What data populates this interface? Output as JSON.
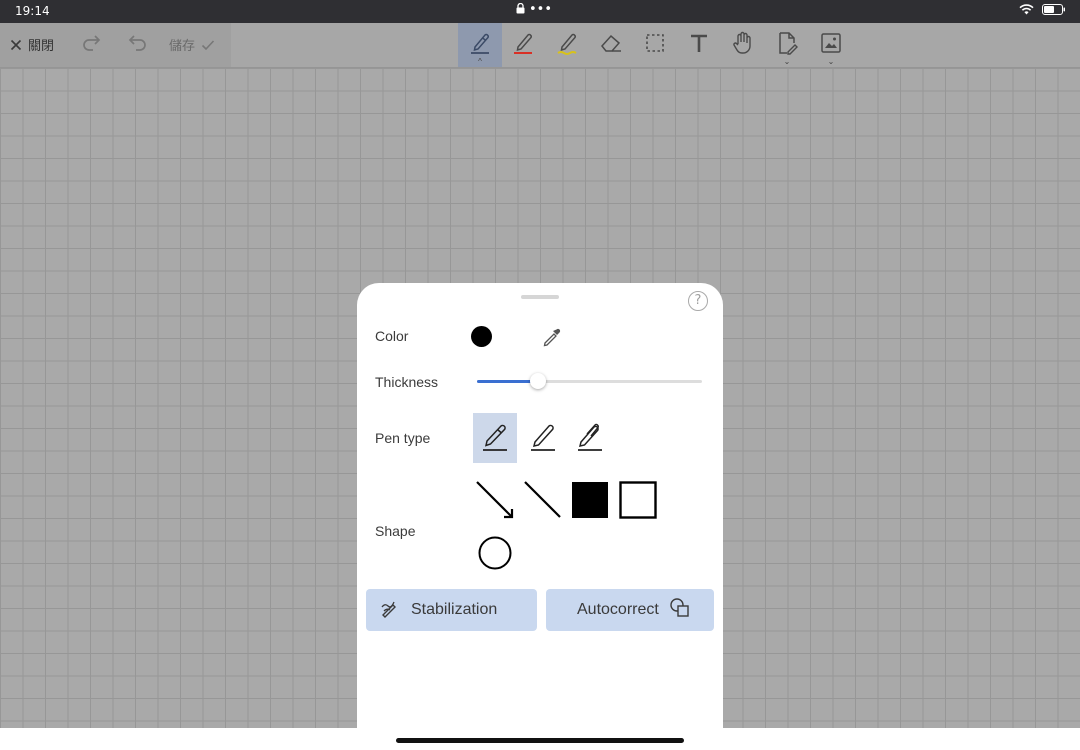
{
  "status_bar": {
    "time": "19:14",
    "dots": "•••"
  },
  "toolbar": {
    "close_label": "關閉",
    "save_label": "儲存",
    "tools": [
      {
        "name": "pen-tool",
        "selected": true,
        "has_caret": true,
        "color": "#3b4a66"
      },
      {
        "name": "red-pen-tool",
        "color": "#d93025"
      },
      {
        "name": "highlighter-tool",
        "color": "#d8c21a"
      },
      {
        "name": "eraser-tool"
      },
      {
        "name": "lasso-select-tool"
      },
      {
        "name": "text-tool"
      },
      {
        "name": "hand-tool"
      },
      {
        "name": "page-tool",
        "has_caret": true
      },
      {
        "name": "image-tool",
        "has_caret": true
      }
    ]
  },
  "pen_panel": {
    "help_glyph": "?",
    "color_label": "Color",
    "current_color": "#000000",
    "thickness_label": "Thickness",
    "thickness_fraction": 0.27,
    "pen_type_label": "Pen type",
    "pen_types": [
      "fountain-pen",
      "ballpoint-pen",
      "brush-pen"
    ],
    "selected_pen_type": 0,
    "shape_label": "Shape",
    "shapes": [
      "arrow",
      "line",
      "filled-rectangle",
      "rectangle",
      "circle"
    ],
    "stabilization_label": "Stabilization",
    "autocorrect_label": "Autocorrect"
  }
}
